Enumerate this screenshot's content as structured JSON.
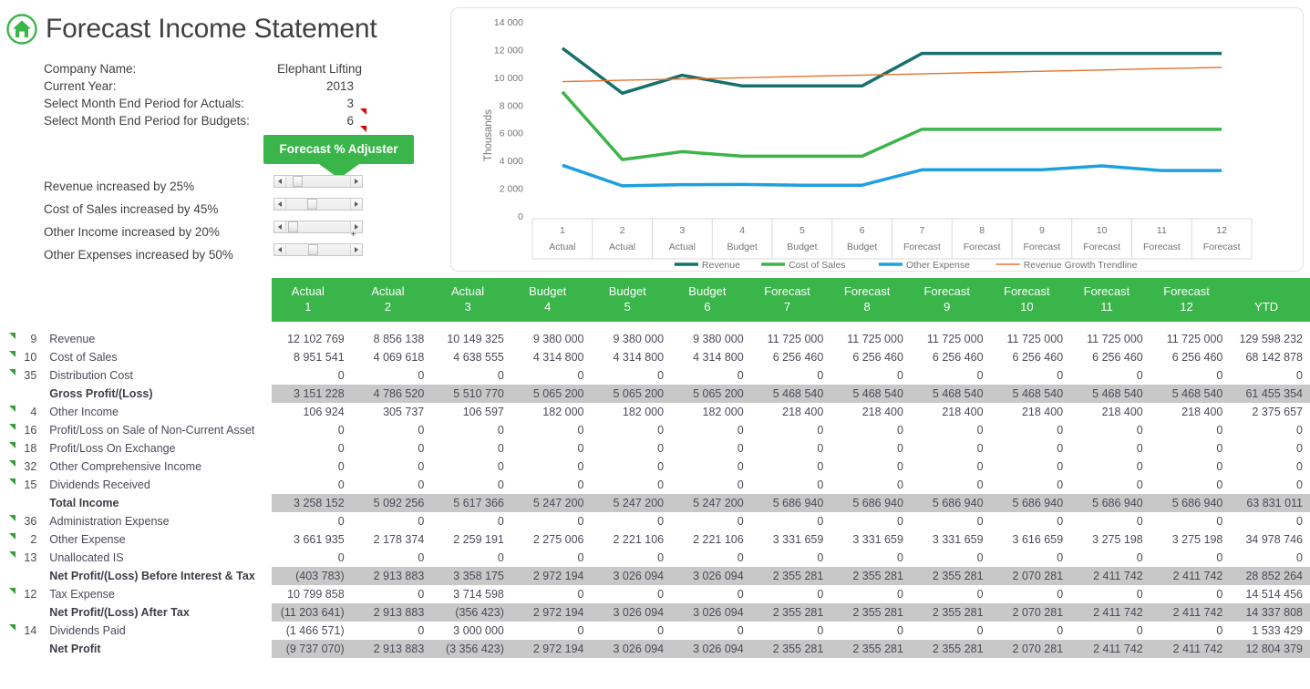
{
  "header": {
    "title": "Forecast Income Statement",
    "home_icon": "home-icon"
  },
  "info": {
    "rows": [
      {
        "label": "Company Name:",
        "value": "Elephant Lifting",
        "comment": false
      },
      {
        "label": "Current Year:",
        "value": "2013",
        "comment": false
      },
      {
        "label": "Select Month End Period for Actuals:",
        "value": "3",
        "comment": true
      },
      {
        "label": "Select Month End Period for Budgets:",
        "value": "6",
        "comment": true
      }
    ]
  },
  "adjuster": {
    "banner": "Forecast % Adjuster",
    "items": [
      {
        "label": "Revenue increased by 25%",
        "percent": 25,
        "thumb_pos": 20
      },
      {
        "label": "Cost of Sales increased by 45%",
        "percent": 45,
        "thumb_pos": 36
      },
      {
        "label": "Other Income increased by 20%",
        "percent": 20,
        "thumb_pos": 15
      },
      {
        "label": "Other Expenses increased by 50%",
        "percent": 50,
        "thumb_pos": 37
      }
    ],
    "tiny_mark": "+"
  },
  "chart_data": {
    "type": "line",
    "title": "",
    "ylabel": "Thousands",
    "xlabel": "",
    "ylim": [
      0,
      14000
    ],
    "yticks": [
      "0",
      "2 000",
      "4 000",
      "6 000",
      "8 000",
      "10 000",
      "12 000",
      "14 000"
    ],
    "ytick_values": [
      0,
      2000,
      4000,
      6000,
      8000,
      10000,
      12000,
      14000
    ],
    "grid": false,
    "legend_position": "bottom",
    "categories": [
      {
        "num": "1",
        "type": "Actual"
      },
      {
        "num": "2",
        "type": "Actual"
      },
      {
        "num": "3",
        "type": "Actual"
      },
      {
        "num": "4",
        "type": "Budget"
      },
      {
        "num": "5",
        "type": "Budget"
      },
      {
        "num": "6",
        "type": "Budget"
      },
      {
        "num": "7",
        "type": "Forecast"
      },
      {
        "num": "8",
        "type": "Forecast"
      },
      {
        "num": "9",
        "type": "Forecast"
      },
      {
        "num": "10",
        "type": "Forecast"
      },
      {
        "num": "11",
        "type": "Forecast"
      },
      {
        "num": "12",
        "type": "Forecast"
      }
    ],
    "series": [
      {
        "name": "Revenue",
        "color": "#16706b",
        "width": 3.5,
        "values": [
          12103,
          8856,
          10149,
          9380,
          9380,
          9380,
          11725,
          11725,
          11725,
          11725,
          11725,
          11725
        ]
      },
      {
        "name": "Cost of Sales",
        "color": "#3cb44a",
        "width": 3.5,
        "values": [
          8952,
          4070,
          4639,
          4315,
          4315,
          4315,
          6256,
          6256,
          6256,
          6256,
          6256,
          6256
        ]
      },
      {
        "name": "Other Expense",
        "color": "#1e9fe0",
        "width": 3.5,
        "values": [
          3662,
          2178,
          2259,
          2275,
          2221,
          2221,
          3332,
          3332,
          3332,
          3617,
          3275,
          3275
        ]
      },
      {
        "name": "Revenue Growth Trendline",
        "color": "#e8702a",
        "width": 1.4,
        "values": [
          9690,
          9790,
          9880,
          9970,
          10070,
          10160,
          10250,
          10350,
          10440,
          10530,
          10630,
          10720
        ]
      }
    ]
  },
  "table": {
    "columns": [
      {
        "top": "Actual",
        "bottom": "1"
      },
      {
        "top": "Actual",
        "bottom": "2"
      },
      {
        "top": "Actual",
        "bottom": "3"
      },
      {
        "top": "Budget",
        "bottom": "4"
      },
      {
        "top": "Budget",
        "bottom": "5"
      },
      {
        "top": "Budget",
        "bottom": "6"
      },
      {
        "top": "Forecast",
        "bottom": "7"
      },
      {
        "top": "Forecast",
        "bottom": "8"
      },
      {
        "top": "Forecast",
        "bottom": "9"
      },
      {
        "top": "Forecast",
        "bottom": "10"
      },
      {
        "top": "Forecast",
        "bottom": "11"
      },
      {
        "top": "Forecast",
        "bottom": "12"
      },
      {
        "top": "",
        "bottom": "YTD"
      }
    ],
    "rows": [
      {
        "code": "9",
        "label": "Revenue",
        "comment": true,
        "total": false,
        "values": [
          "12 102 769",
          "8 856 138",
          "10 149 325",
          "9 380 000",
          "9 380 000",
          "9 380 000",
          "11 725 000",
          "11 725 000",
          "11 725 000",
          "11 725 000",
          "11 725 000",
          "11 725 000",
          "129 598 232"
        ]
      },
      {
        "code": "10",
        "label": "Cost of Sales",
        "comment": true,
        "total": false,
        "values": [
          "8 951 541",
          "4 069 618",
          "4 638 555",
          "4 314 800",
          "4 314 800",
          "4 314 800",
          "6 256 460",
          "6 256 460",
          "6 256 460",
          "6 256 460",
          "6 256 460",
          "6 256 460",
          "68 142 878"
        ]
      },
      {
        "code": "35",
        "label": "Distribution Cost",
        "comment": true,
        "total": false,
        "values": [
          "0",
          "0",
          "0",
          "0",
          "0",
          "0",
          "0",
          "0",
          "0",
          "0",
          "0",
          "0",
          "0"
        ]
      },
      {
        "code": "",
        "label": "Gross Profit/(Loss)",
        "comment": false,
        "total": true,
        "values": [
          "3 151 228",
          "4 786 520",
          "5 510 770",
          "5 065 200",
          "5 065 200",
          "5 065 200",
          "5 468 540",
          "5 468 540",
          "5 468 540",
          "5 468 540",
          "5 468 540",
          "5 468 540",
          "61 455 354"
        ]
      },
      {
        "code": "4",
        "label": "Other Income",
        "comment": true,
        "total": false,
        "values": [
          "106 924",
          "305 737",
          "106 597",
          "182 000",
          "182 000",
          "182 000",
          "218 400",
          "218 400",
          "218 400",
          "218 400",
          "218 400",
          "218 400",
          "2 375 657"
        ]
      },
      {
        "code": "16",
        "label": "Profit/Loss on Sale of Non-Current Asset",
        "comment": true,
        "total": false,
        "values": [
          "0",
          "0",
          "0",
          "0",
          "0",
          "0",
          "0",
          "0",
          "0",
          "0",
          "0",
          "0",
          "0"
        ]
      },
      {
        "code": "18",
        "label": "Profit/Loss On Exchange",
        "comment": true,
        "total": false,
        "values": [
          "0",
          "0",
          "0",
          "0",
          "0",
          "0",
          "0",
          "0",
          "0",
          "0",
          "0",
          "0",
          "0"
        ]
      },
      {
        "code": "32",
        "label": "Other Comprehensive Income",
        "comment": true,
        "total": false,
        "values": [
          "0",
          "0",
          "0",
          "0",
          "0",
          "0",
          "0",
          "0",
          "0",
          "0",
          "0",
          "0",
          "0"
        ]
      },
      {
        "code": "15",
        "label": "Dividends Received",
        "comment": true,
        "total": false,
        "values": [
          "0",
          "0",
          "0",
          "0",
          "0",
          "0",
          "0",
          "0",
          "0",
          "0",
          "0",
          "0",
          "0"
        ]
      },
      {
        "code": "",
        "label": "Total Income",
        "comment": false,
        "total": true,
        "values": [
          "3 258 152",
          "5 092 256",
          "5 617 366",
          "5 247 200",
          "5 247 200",
          "5 247 200",
          "5 686 940",
          "5 686 940",
          "5 686 940",
          "5 686 940",
          "5 686 940",
          "5 686 940",
          "63 831 011"
        ]
      },
      {
        "code": "36",
        "label": "Administration Expense",
        "comment": true,
        "total": false,
        "values": [
          "0",
          "0",
          "0",
          "0",
          "0",
          "0",
          "0",
          "0",
          "0",
          "0",
          "0",
          "0",
          "0"
        ]
      },
      {
        "code": "2",
        "label": "Other Expense",
        "comment": true,
        "total": false,
        "values": [
          "3 661 935",
          "2 178 374",
          "2 259 191",
          "2 275 006",
          "2 221 106",
          "2 221 106",
          "3 331 659",
          "3 331 659",
          "3 331 659",
          "3 616 659",
          "3 275 198",
          "3 275 198",
          "34 978 746"
        ]
      },
      {
        "code": "13",
        "label": "Unallocated IS",
        "comment": true,
        "total": false,
        "values": [
          "0",
          "0",
          "0",
          "0",
          "0",
          "0",
          "0",
          "0",
          "0",
          "0",
          "0",
          "0",
          "0"
        ]
      },
      {
        "code": "",
        "label": "Net Profit/(Loss) Before Interest & Tax",
        "comment": false,
        "total": true,
        "values": [
          "(403 783)",
          "2 913 883",
          "3 358 175",
          "2 972 194",
          "3 026 094",
          "3 026 094",
          "2 355 281",
          "2 355 281",
          "2 355 281",
          "2 070 281",
          "2 411 742",
          "2 411 742",
          "28 852 264"
        ]
      },
      {
        "code": "12",
        "label": "Tax Expense",
        "comment": true,
        "total": false,
        "values": [
          "10 799 858",
          "0",
          "3 714 598",
          "0",
          "0",
          "0",
          "0",
          "0",
          "0",
          "0",
          "0",
          "0",
          "14 514 456"
        ]
      },
      {
        "code": "",
        "label": "Net Profit/(Loss) After Tax",
        "comment": false,
        "total": true,
        "values": [
          "(11 203 641)",
          "2 913 883",
          "(356 423)",
          "2 972 194",
          "3 026 094",
          "3 026 094",
          "2 355 281",
          "2 355 281",
          "2 355 281",
          "2 070 281",
          "2 411 742",
          "2 411 742",
          "14 337 808"
        ]
      },
      {
        "code": "14",
        "label": "Dividends Paid",
        "comment": true,
        "total": false,
        "values": [
          "(1 466 571)",
          "0",
          "3 000 000",
          "0",
          "0",
          "0",
          "0",
          "0",
          "0",
          "0",
          "0",
          "0",
          "1 533 429"
        ]
      },
      {
        "code": "",
        "label": "Net Profit",
        "comment": false,
        "total": true,
        "values": [
          "(9 737 070)",
          "2 913 883",
          "(3 356 423)",
          "2 972 194",
          "3 026 094",
          "3 026 094",
          "2 355 281",
          "2 355 281",
          "2 355 281",
          "2 070 281",
          "2 411 742",
          "2 411 742",
          "12 804 379"
        ]
      }
    ]
  },
  "colors": {
    "brand_green": "#39b54a",
    "header_green": "#39b54a",
    "total_gray": "#c8c8c8",
    "text_gray": "#404040",
    "comment_green": "#3a9b3a",
    "comment_red": "#e00000"
  }
}
